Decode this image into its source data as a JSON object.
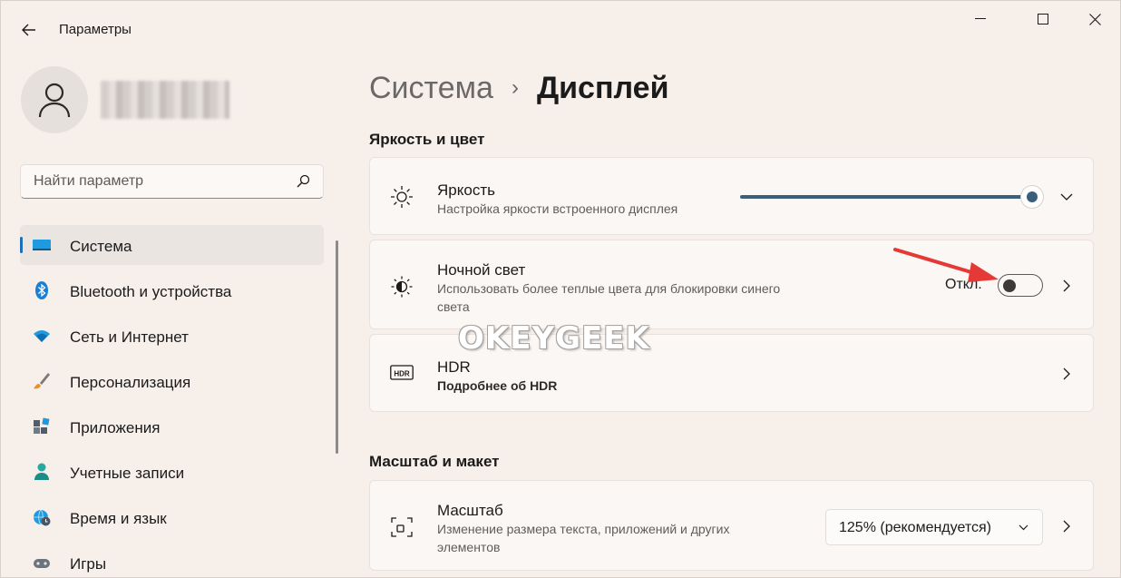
{
  "window": {
    "title": "Параметры"
  },
  "search": {
    "placeholder": "Найти параметр"
  },
  "sidebar": {
    "items": [
      {
        "label": "Система",
        "icon": "display-icon",
        "active": true
      },
      {
        "label": "Bluetooth и устройства",
        "icon": "bluetooth-icon"
      },
      {
        "label": "Сеть и Интернет",
        "icon": "wifi-icon"
      },
      {
        "label": "Персонализация",
        "icon": "brush-icon"
      },
      {
        "label": "Приложения",
        "icon": "apps-icon"
      },
      {
        "label": "Учетные записи",
        "icon": "person-icon"
      },
      {
        "label": "Время и язык",
        "icon": "globe-clock-icon"
      },
      {
        "label": "Игры",
        "icon": "gamepad-icon"
      }
    ]
  },
  "breadcrumb": {
    "parent": "Система",
    "separator": "›",
    "current": "Дисплей"
  },
  "sections": {
    "brightness_color": "Яркость и цвет",
    "scale_layout": "Масштаб и макет"
  },
  "brightness": {
    "title": "Яркость",
    "subtitle": "Настройка яркости встроенного дисплея",
    "level_percent": 100
  },
  "night_light": {
    "title": "Ночной свет",
    "subtitle_line1": "Использовать более теплые цвета для блокировки синего",
    "subtitle_line2": "света",
    "toggle_label": "Откл.",
    "enabled": false
  },
  "hdr": {
    "icon_text": "HDR",
    "title": "HDR",
    "link": "Подробнее об HDR"
  },
  "scale": {
    "title": "Масштаб",
    "subtitle_line1": "Изменение размера текста, приложений и других",
    "subtitle_line2": "элементов",
    "value": "125% (рекомендуется)"
  },
  "watermark": "OKEYGEEK",
  "colors": {
    "accent": "#1f6fb6",
    "arrow": "#e53935",
    "slider": "#3a5f7a"
  }
}
